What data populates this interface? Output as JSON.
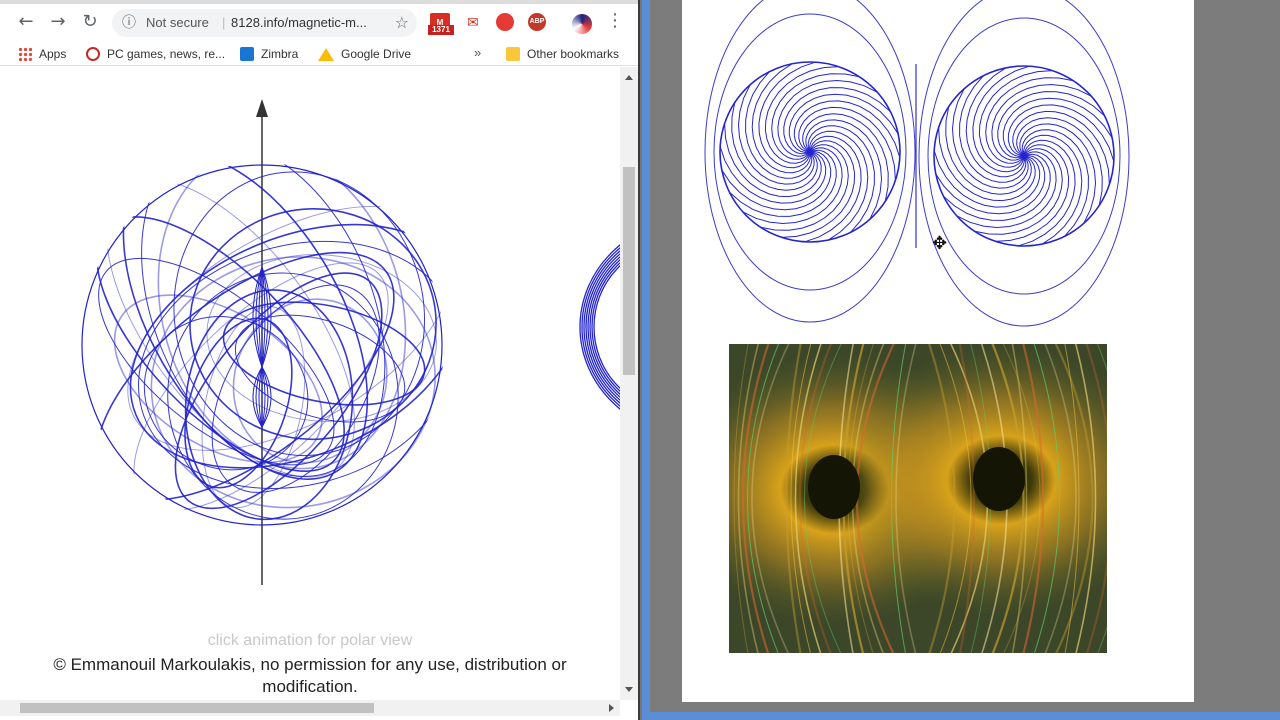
{
  "browser": {
    "nav": {
      "back_icon": "←",
      "forward_icon": "→",
      "reload_icon": "↻"
    },
    "omnibox": {
      "security_label": "Not secure",
      "separator": "|",
      "url": "8128.info/magnetic-m...",
      "info_icon": "ⓘ",
      "star_icon": "☆"
    },
    "extensions": {
      "gmail_count": "1371",
      "gmail_glyph": "M",
      "mail_glyph": "✉",
      "abp_label": "ABP",
      "menu_icon": "⋮"
    },
    "bookmarks": [
      {
        "label": "Apps",
        "icon": "apps-grid-icon"
      },
      {
        "label": "PC games, news, re...",
        "icon": "pc-games-icon"
      },
      {
        "label": "Zimbra",
        "icon": "zimbra-icon"
      },
      {
        "label": "Google Drive",
        "icon": "google-drive-icon"
      }
    ],
    "bookmarks_more": "»",
    "other_bookmarks": "Other bookmarks"
  },
  "page": {
    "caption": "click animation for polar view",
    "copyright": "© Emmanouil Markoulakis, no permission for any use, distribution or modification."
  },
  "colors": {
    "field_line": "#2222cc",
    "toolbar_bg": "#ffffff",
    "viewer_bg": "#7c7c7c",
    "viewer_frame": "#5b8ed6"
  }
}
